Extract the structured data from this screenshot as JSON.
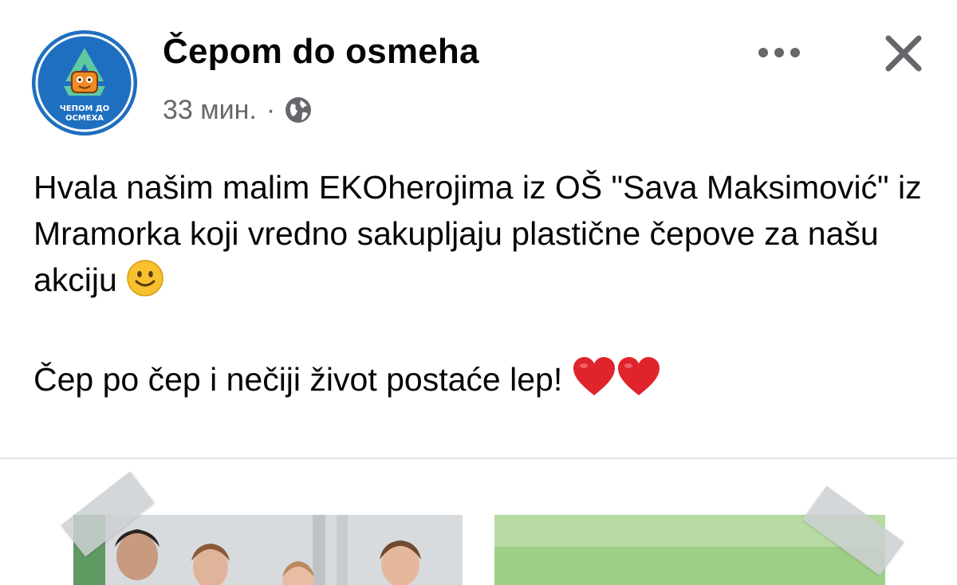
{
  "post": {
    "page_name": "Čepom do osmeha",
    "avatar_label_line1": "ЧЕПОМ ДО",
    "avatar_label_line2": "ОСМЕХА",
    "time": "33 мин.",
    "separator": "·",
    "audience_icon": "globe-icon",
    "more_icon": "more-horizontal-icon",
    "close_icon": "close-icon",
    "paragraph_1": "Hvala našim malim EKOherojima iz OŠ \"Sava Maksimović\" iz Mramorka koji vredno sakupljaju plastične čepove za našu akciju",
    "paragraph_1_emoji": "slightly-smiling-face-emoji",
    "paragraph_2": "Čep po čep i nečiji život postaće lep!",
    "paragraph_2_emoji": "red-heart-emoji x2"
  },
  "colors": {
    "avatar_bg": "#1f6fc0",
    "avatar_ring": "#ffffff",
    "recycle_arrows": "#5fc9a0",
    "meta_text": "#65676b",
    "divider": "#e4e6eb",
    "heart": "#e0242c",
    "smiley": "#f7c12e"
  }
}
